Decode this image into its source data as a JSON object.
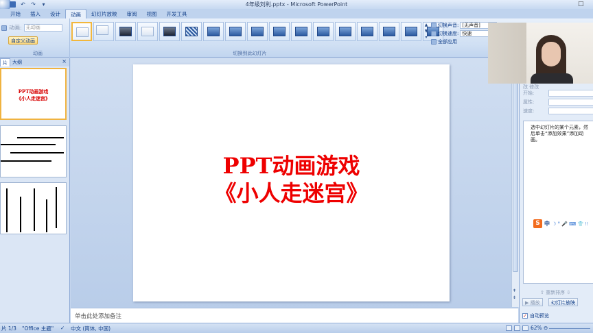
{
  "window": {
    "title": "4年级刘利.pptx - Microsoft PowerPoint",
    "restore_glyph": "□"
  },
  "qat": {
    "undo": "↶",
    "redo": "↷",
    "more": "▾"
  },
  "tabs": [
    "开始",
    "插入",
    "设计",
    "动画",
    "幻灯片放映",
    "审阅",
    "视图",
    "开发工具"
  ],
  "active_tab": "动画",
  "ribbon": {
    "anim_label": "动画:",
    "anim_value": "无动画",
    "custom_anim": "自定义动画",
    "group_anim": "动画",
    "group_transition": "切换到此幻灯片",
    "sound_label": "切换声音:",
    "sound_value": "[无声音]",
    "speed_label": "切换速度:",
    "speed_value": "快速",
    "apply_all": "全部应用"
  },
  "left_panel": {
    "tab_slides": "片",
    "tab_outline": "大纲",
    "close": "×",
    "thumb1_line1": "PPT动画游戏",
    "thumb1_line2": "《小人走迷宫》"
  },
  "slide": {
    "line1": "PPT动画游戏",
    "line2": "《小人走迷宫》"
  },
  "notes_placeholder": "单击此处添加备注",
  "right_pane": {
    "field_header": "改 修改",
    "start_label": "开始:",
    "property_label": "属性:",
    "speed_label": "速度:",
    "hint": "选中幻灯片的某个元素，然后单击“添加效果”添加动画。",
    "ime_s": "S",
    "ime_text": "中",
    "ime_symbols": "☽ ° 🎤 ⌨ 👕 ⁝⁝",
    "reorder": "重新排序",
    "play": "▶ 播放",
    "slideshow": "幻灯片放映",
    "autopreview": "自动预览",
    "autopreview_check": "✓"
  },
  "statusbar": {
    "slide_count": "片 1/3",
    "theme": "\"Office 主题\"",
    "language": "中文 (简体, 中国)",
    "zoom": "62%",
    "zoom_minus": "⊖"
  }
}
